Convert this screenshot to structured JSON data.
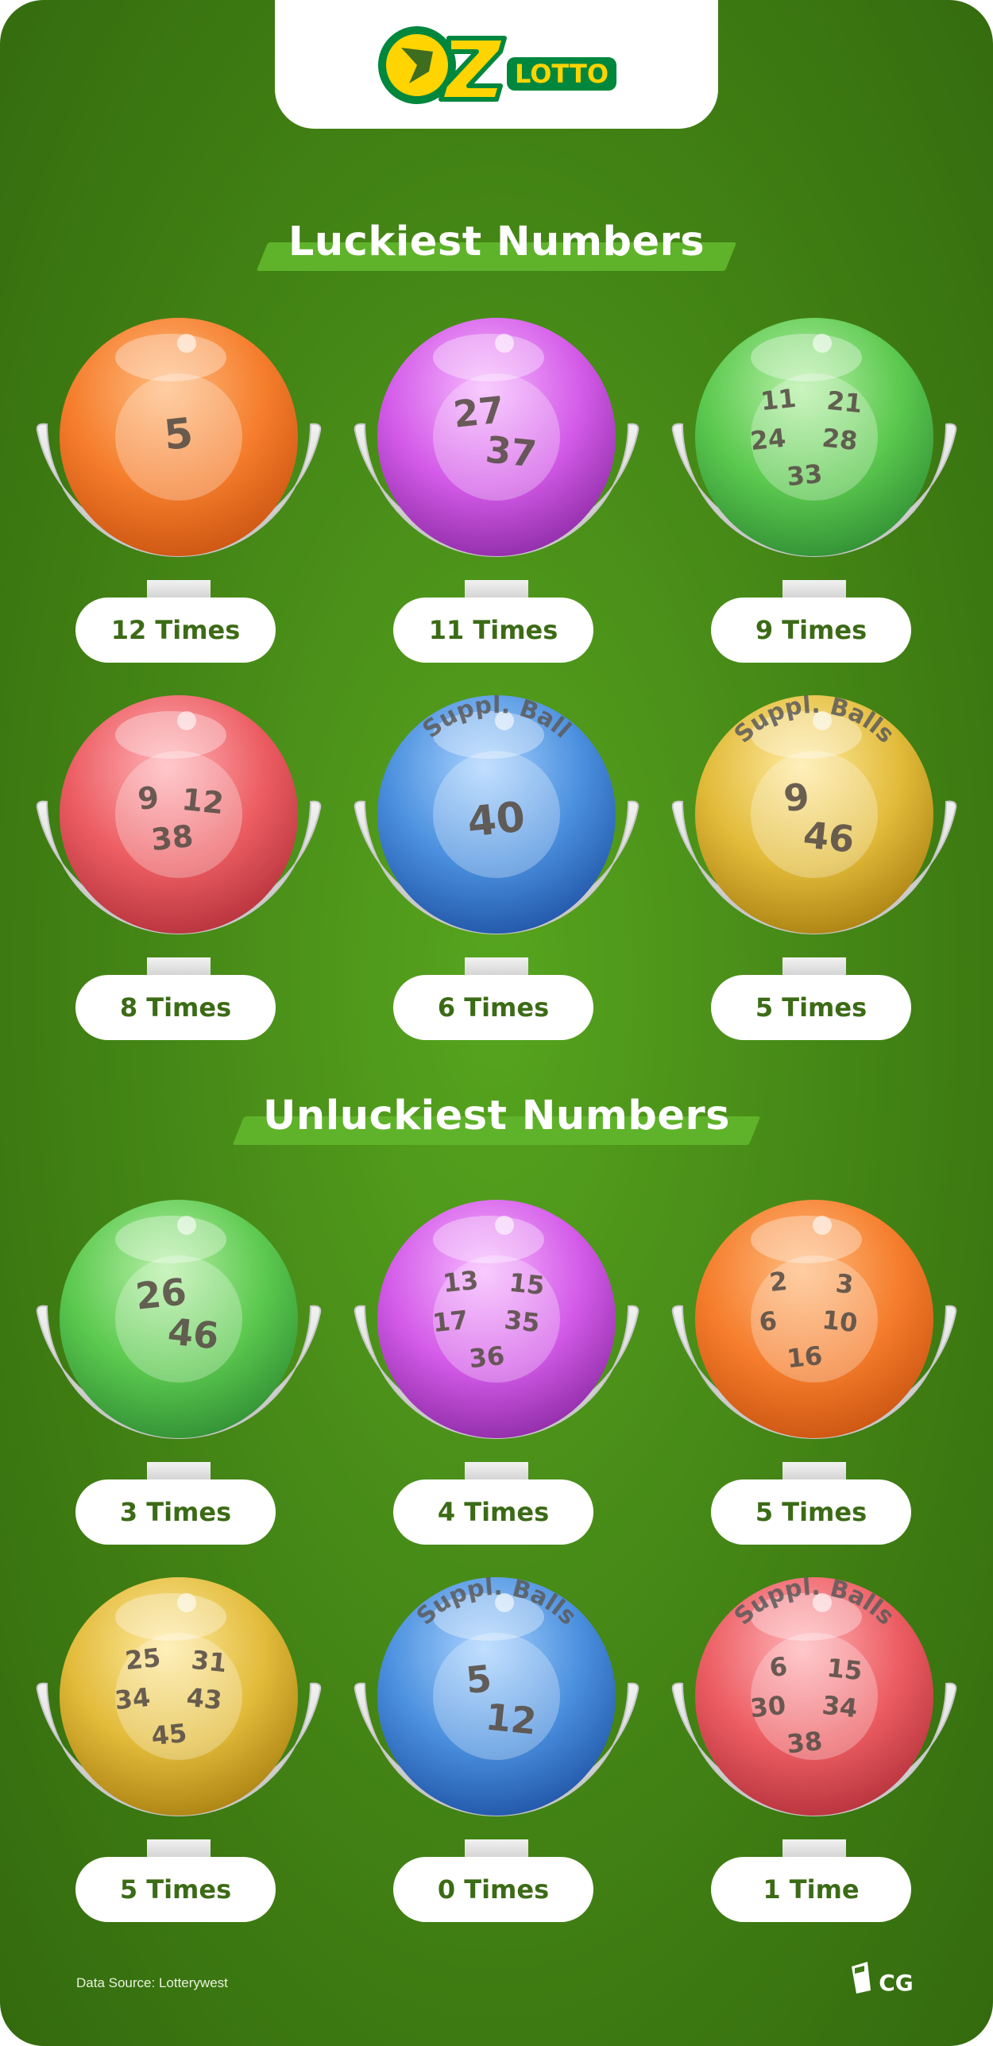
{
  "header": {
    "logo_text": "OZ LOTTO",
    "logo_colors": {
      "ring": "#00873e",
      "yellow": "#ffd400",
      "dark": "#1c5a24"
    }
  },
  "sections": [
    {
      "title": "Luckiest Numbers",
      "balls": [
        {
          "color": "orange",
          "label": "",
          "numbers": [
            "5"
          ],
          "times": "12 Times"
        },
        {
          "color": "purple",
          "label": "",
          "numbers": [
            "27",
            "37"
          ],
          "times": "11 Times"
        },
        {
          "color": "green",
          "label": "",
          "numbers": [
            "11",
            "21",
            "24",
            "28",
            "33"
          ],
          "times": "9 Times"
        },
        {
          "color": "red",
          "label": "",
          "numbers": [
            "9",
            "12",
            "38"
          ],
          "times": "8 Times"
        },
        {
          "color": "blue",
          "label": "Suppl. Ball",
          "numbers": [
            "40"
          ],
          "times": "6 Times"
        },
        {
          "color": "yellow",
          "label": "Suppl. Balls",
          "numbers": [
            "9",
            "46"
          ],
          "times": "5 Times"
        }
      ]
    },
    {
      "title": "Unluckiest Numbers",
      "balls": [
        {
          "color": "green",
          "label": "",
          "numbers": [
            "26",
            "46"
          ],
          "times": "3 Times"
        },
        {
          "color": "purple",
          "label": "",
          "numbers": [
            "13",
            "15",
            "17",
            "35",
            "36"
          ],
          "times": "4 Times"
        },
        {
          "color": "orange",
          "label": "",
          "numbers": [
            "2",
            "3",
            "6",
            "10",
            "16"
          ],
          "times": "5 Times"
        },
        {
          "color": "yellow",
          "label": "",
          "numbers": [
            "25",
            "31",
            "34",
            "43",
            "45"
          ],
          "times": "5 Times"
        },
        {
          "color": "blue",
          "label": "Suppl. Balls",
          "numbers": [
            "5",
            "12"
          ],
          "times": "0 Times"
        },
        {
          "color": "red",
          "label": "Suppl. Balls",
          "numbers": [
            "6",
            "15",
            "30",
            "34",
            "38"
          ],
          "times": "1 Time"
        }
      ]
    }
  ],
  "ball_colors": {
    "orange": {
      "light": "#ffbb7e",
      "mid": "#f57d2c",
      "dark": "#c95310"
    },
    "purple": {
      "light": "#f6b7ff",
      "mid": "#d35ae8",
      "dark": "#8b2aa3"
    },
    "green": {
      "light": "#b6f0a6",
      "mid": "#5cc94f",
      "dark": "#2f8d33"
    },
    "red": {
      "light": "#ffb3b8",
      "mid": "#ec5d62",
      "dark": "#b3303a"
    },
    "blue": {
      "light": "#a9d3ff",
      "mid": "#4a8fde",
      "dark": "#1f52a4"
    },
    "yellow": {
      "light": "#ffeaa0",
      "mid": "#e2bb3a",
      "dark": "#a87f10"
    }
  },
  "footer": {
    "source": "Data Source: Lotterywest",
    "brand": "CG"
  }
}
